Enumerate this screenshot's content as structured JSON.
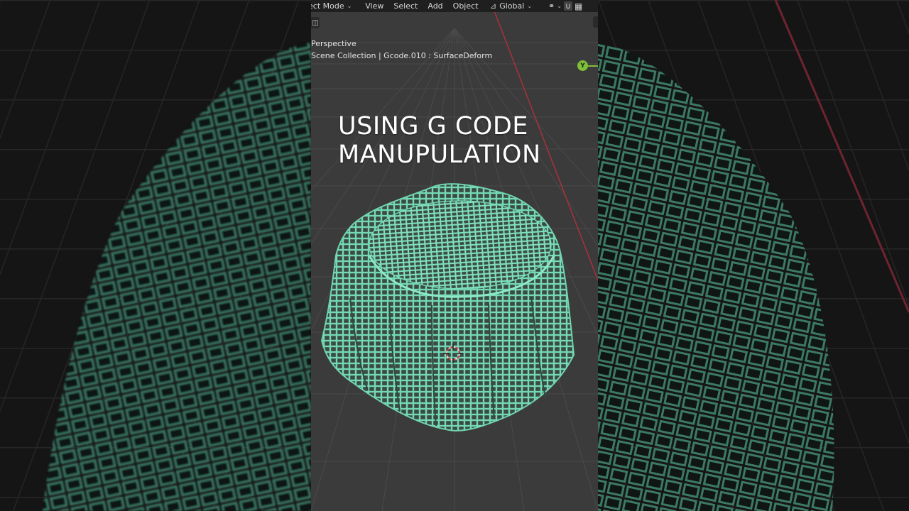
{
  "header": {
    "mode_label": "ect Mode",
    "menu": [
      "View",
      "Select",
      "Add",
      "Object"
    ],
    "orientation_label": "Global"
  },
  "viewport": {
    "view_label": "Perspective",
    "collection_label": "Scene Collection | Gcode.010 : SurfaceDeform",
    "axis_gizmo_label": "Y"
  },
  "caption": {
    "line1": "USING G CODE",
    "line2": "MANUPULATION"
  },
  "colors": {
    "mesh": "#6fd3b0",
    "grid": "#4a4a4a",
    "background": "#3d3d3d",
    "x_axis": "#a8323c",
    "y_axis_gizmo": "#7fbf3a"
  },
  "icons": [
    "mode-chevron-icon",
    "transform-orientation-icon",
    "pivot-icon",
    "snap-icon",
    "overlay-grid-icon",
    "tool-settings-icon",
    "3d-cursor-icon"
  ]
}
